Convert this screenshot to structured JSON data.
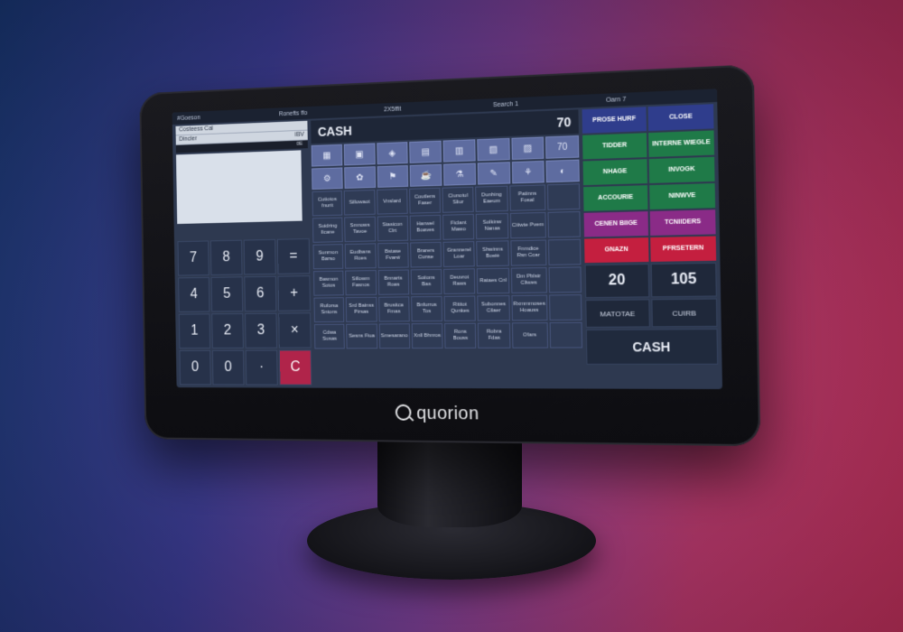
{
  "brand": {
    "name": "quorion"
  },
  "topbar": {
    "items": [
      "#Goeson",
      "Ronefts ffo",
      "2X5ffit",
      "Search 1",
      "Oarn 7"
    ]
  },
  "left_panel": {
    "ticket_lines": [
      {
        "label": "Costeess Cal",
        "value": ""
      },
      {
        "label": "Dincler",
        "value": "iBV"
      }
    ],
    "dark_bar_label": "0E"
  },
  "numpad": {
    "keys": [
      "7",
      "8",
      "9",
      "=",
      "4",
      "5",
      "6",
      "+",
      "1",
      "2",
      "3",
      "×",
      "0",
      "0",
      "·",
      "C"
    ]
  },
  "middle": {
    "header_title": "CASH",
    "header_value": "70",
    "icon_row_1": [
      "▦",
      "▣",
      "◈",
      "▤",
      "▥",
      "▧",
      "▨",
      "70"
    ],
    "icon_row_2": [
      "⚙",
      "✿",
      "⚑",
      "☕",
      "⚗",
      "✎",
      "⚘",
      "◐"
    ],
    "products": [
      "Cutiotos fnurit",
      "Sillowaot",
      "Vnslard",
      "Coutlens Faser",
      "Ciunotul Sliur",
      "Dunhing Eaeum",
      "Patinns Fosal",
      "",
      "Suidring Ilcane",
      "Smnows Tavoe",
      "Stasicon Clrt",
      "Hanwel Boaves",
      "Ficlant Mawo",
      "Solkinw Nanas",
      "Ciiiwte Pvem",
      "",
      "Sunrnon Barso",
      "Eudbans Roes",
      "Bstase Fvarw",
      "Brarers Cunse",
      "Grannerel Loar",
      "Shwinns Bowe",
      "Fnmdice Rsn Ccar",
      "",
      "Basmon Sotos",
      "Sillowm Fasnos",
      "Bnnarts Roas",
      "Soiions Bas",
      "Deuvrot Raws",
      "Rataes Cnl",
      "Dm Pblstr Cliwes",
      "",
      "Ruforsa Sntons",
      "Srd Bainss Pirsas",
      "Brusitca Fmas",
      "Bnfurrus Tos",
      "Rititot Qunkes",
      "Subonnes Cilaer",
      "Rxmmmoses Hoauss",
      "",
      "Cdwa Susas",
      "Sesns Fiua",
      "Smesarano",
      "Xnll Bhnros",
      "Rons Bouss",
      "Robra Fdas",
      "Ofars",
      ""
    ]
  },
  "right": {
    "function_buttons": [
      {
        "label": "PROSE HURF",
        "color": "blue"
      },
      {
        "label": "CLOSE",
        "color": "blue"
      },
      {
        "label": "TIDDER",
        "color": "green"
      },
      {
        "label": "INTERNE WIEGLE",
        "color": "green"
      },
      {
        "label": "NHAGE",
        "color": "green"
      },
      {
        "label": "INVOGK",
        "color": "green"
      },
      {
        "label": "ACCOURIE",
        "color": "green"
      },
      {
        "label": "NINWVE",
        "color": "green"
      },
      {
        "label": "CENEN BIIGE",
        "color": "magenta"
      },
      {
        "label": "TCNIIDERS",
        "color": "magenta"
      },
      {
        "label": "GNAZN",
        "color": "red"
      },
      {
        "label": "PFRSETERN",
        "color": "red"
      }
    ],
    "num_tiles": [
      "20",
      "105"
    ],
    "small_tiles": [
      "MATOTAE",
      "CUIRB"
    ],
    "cash_button": "CASH"
  },
  "colors": {
    "accent_red": "#c41f3f",
    "accent_green": "#1f7a48",
    "accent_blue": "#2f3d8c",
    "accent_magenta": "#8a2b87"
  }
}
